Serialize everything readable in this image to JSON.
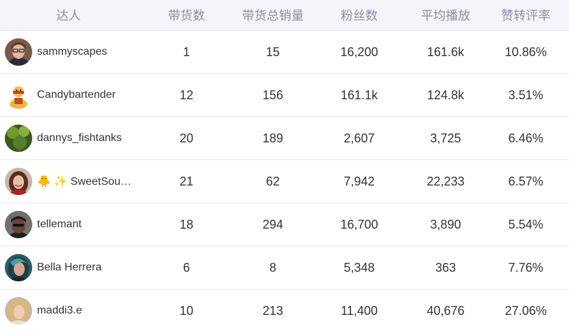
{
  "table": {
    "headers": [
      "达人",
      "带货数",
      "带货总销量",
      "粉丝数",
      "平均播放",
      "赞转评率"
    ],
    "rows": [
      {
        "name": "sammyscapes",
        "goods": "1",
        "sales": "15",
        "fans": "16,200",
        "avg_play": "161.6k",
        "rate": "10.86%",
        "avatar_icon": "person-glasses-icon"
      },
      {
        "name": "Candybartender",
        "goods": "12",
        "sales": "156",
        "fans": "161.1k",
        "avg_play": "124.8k",
        "rate": "3.51%",
        "avatar_icon": "wrestler-cartoon-icon"
      },
      {
        "name": "dannys_fishtanks",
        "goods": "20",
        "sales": "189",
        "fans": "2,607",
        "avg_play": "3,725",
        "rate": "6.46%",
        "avatar_icon": "aquarium-plant-icon"
      },
      {
        "name": "🐥 ✨ SweetSou…",
        "goods": "21",
        "sales": "62",
        "fans": "7,942",
        "avg_play": "22,233",
        "rate": "6.57%",
        "avatar_icon": "person-woman-icon"
      },
      {
        "name": "tellemant",
        "goods": "18",
        "sales": "294",
        "fans": "16,700",
        "avg_play": "3,890",
        "rate": "5.54%",
        "avatar_icon": "person-man-cap-icon"
      },
      {
        "name": "Bella Herrera",
        "goods": "6",
        "sales": "8",
        "fans": "5,348",
        "avg_play": "363",
        "rate": "7.76%",
        "avatar_icon": "person-teal-hair-icon"
      },
      {
        "name": "maddi3.e",
        "goods": "10",
        "sales": "213",
        "fans": "11,400",
        "avg_play": "40,676",
        "rate": "27.06%",
        "avatar_icon": "person-blonde-icon"
      }
    ]
  }
}
